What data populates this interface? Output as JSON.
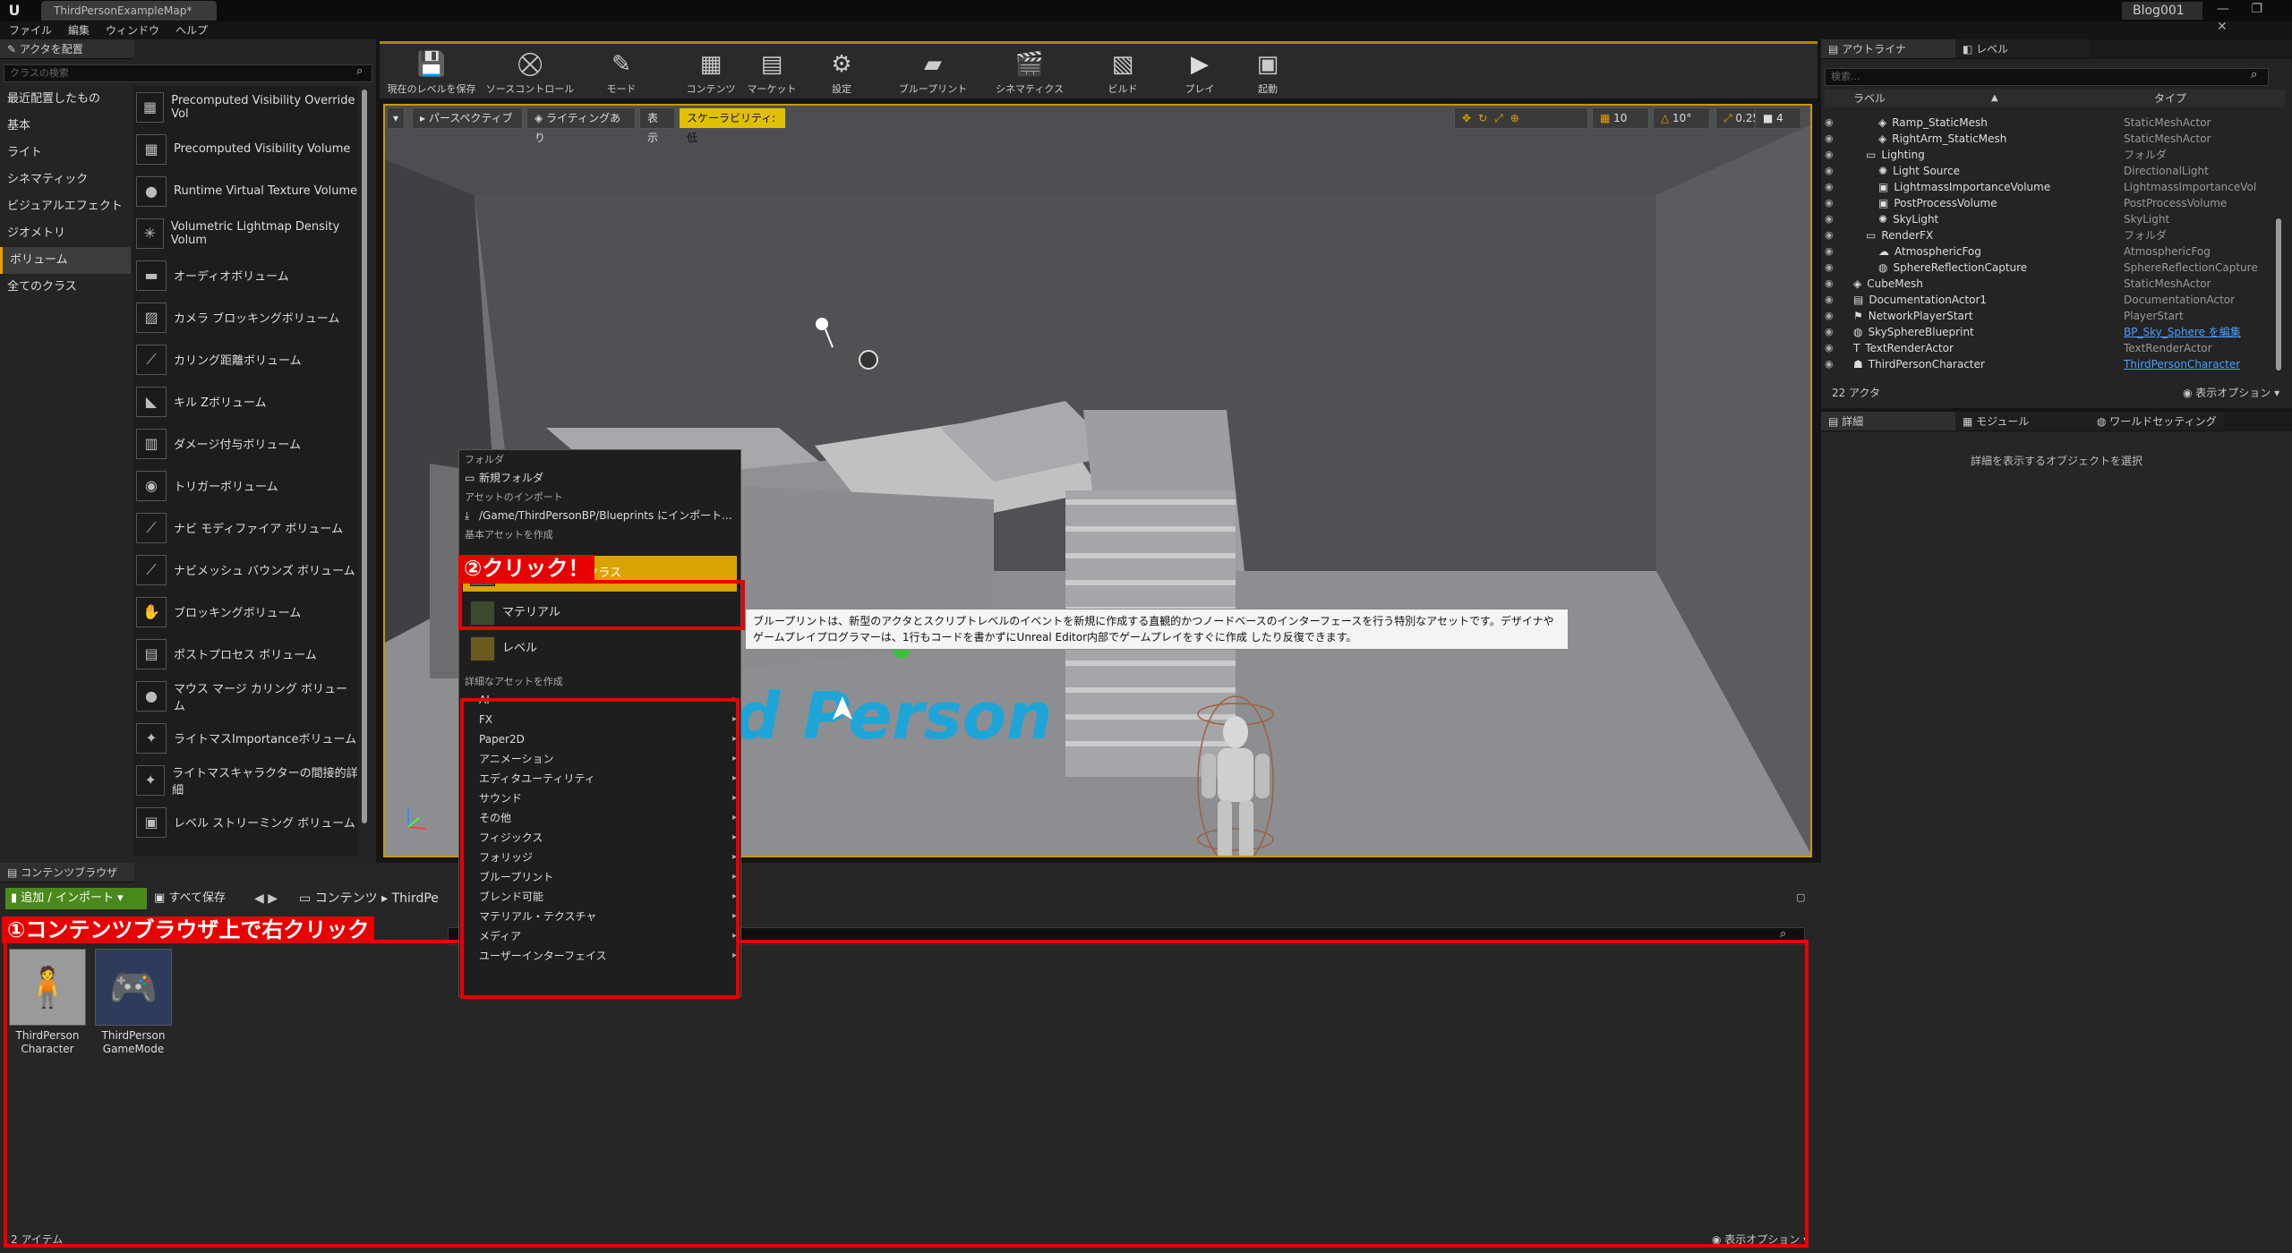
{
  "title_bar": {
    "doc_tab": "ThirdPersonExampleMap*",
    "project": "Blog001",
    "window_controls": "— ❐ ✕"
  },
  "menu": [
    "ファイル",
    "編集",
    "ウィンドウ",
    "ヘルプ"
  ],
  "place_actors": {
    "tab": "アクタを配置",
    "search_placeholder": "クラスの検索",
    "categories": [
      "最近配置したもの",
      "基本",
      "ライト",
      "シネマティック",
      "ビジュアルエフェクト",
      "ジオメトリ",
      "ボリューム",
      "全てのクラス"
    ],
    "items": [
      "Precomputed Visibility Override Vol",
      "Precomputed Visibility Volume",
      "Runtime Virtual Texture Volume",
      "Volumetric Lightmap Density Volum",
      "オーディオボリューム",
      "カメラ ブロッキングボリューム",
      "カリング距離ボリューム",
      "キル Zボリューム",
      "ダメージ付与ボリューム",
      "トリガーボリューム",
      "ナビ モディファイア ボリューム",
      "ナビメッシュ バウンズ ボリューム",
      "ブロッキングボリューム",
      "ポストプロセス ボリューム",
      "マウス マージ カリング ボリューム",
      "ライトマスImportanceボリューム",
      "ライトマスキャラクターの間接的詳細",
      "レベル ストリーミング ボリューム"
    ]
  },
  "toolbar": [
    "現在のレベルを保存",
    "ソースコントロール",
    "モード",
    "コンテンツ",
    "マーケット",
    "設定",
    "ブループリント",
    "シネマティクス",
    "ビルド",
    "プレイ",
    "起動"
  ],
  "viewport": {
    "buttons": [
      "パースペクティブ",
      "ライティングあり",
      "表示",
      "スケーラビリティ:低"
    ],
    "snap": [
      "10",
      "10°",
      "0.25",
      "4"
    ],
    "text_3d": "d Person"
  },
  "context_menu": {
    "folder_section": "フォルダ",
    "new_folder": "新規フォルダ",
    "import_section": "アセットのインポート",
    "import_path": "/Game/ThirdPersonBP/Blueprints にインポート...",
    "basic_section": "基本アセットを作成",
    "blueprint_class": "ブループリント クラス",
    "material": "マテリアル",
    "level": "レベル",
    "advanced_section": "詳細なアセットを作成",
    "advanced_items": [
      "AI",
      "FX",
      "Paper2D",
      "アニメーション",
      "エディタユーティリティ",
      "サウンド",
      "その他",
      "フィジックス",
      "フォリッジ",
      "ブループリント",
      "ブレンド可能",
      "マテリアル・テクスチャ",
      "メディア",
      "ユーザーインターフェイス"
    ]
  },
  "tooltip": "ブループリントは、新型のアクタとスクリプトレベルのイベントを新規に作成する直観的かつノードベースのインターフェースを行う特別なアセットです。デザイナやゲームプレイプログラマーは、1行もコードを書かずにUnreal Editor内部でゲームプレイをすぐに作成 したり反復できます。",
  "annotations": {
    "step1": "①コンテンツブラウザ上で右クリック",
    "step2": "②クリック！"
  },
  "outliner": {
    "tabs": [
      "アウトライナ",
      "レベル"
    ],
    "search_placeholder": "検索...",
    "col_label": "ラベル",
    "col_type": "タイプ",
    "rows": [
      {
        "label": "Ramp_StaticMesh",
        "type": "StaticMeshActor",
        "indent": 3,
        "icon": "mesh-icon"
      },
      {
        "label": "RightArm_StaticMesh",
        "type": "StaticMeshActor",
        "indent": 3,
        "icon": "mesh-icon"
      },
      {
        "label": "Lighting",
        "type": "フォルダ",
        "indent": 2,
        "icon": "folder-icon"
      },
      {
        "label": "Light Source",
        "type": "DirectionalLight",
        "indent": 3,
        "icon": "light-icon"
      },
      {
        "label": "LightmassImportanceVolume",
        "type": "LightmassImportanceVol",
        "indent": 3,
        "icon": "volume-icon"
      },
      {
        "label": "PostProcessVolume",
        "type": "PostProcessVolume",
        "indent": 3,
        "icon": "volume-icon"
      },
      {
        "label": "SkyLight",
        "type": "SkyLight",
        "indent": 3,
        "icon": "light-icon"
      },
      {
        "label": "RenderFX",
        "type": "フォルダ",
        "indent": 2,
        "icon": "folder-icon"
      },
      {
        "label": "AtmosphericFog",
        "type": "AtmosphericFog",
        "indent": 3,
        "icon": "fog-icon"
      },
      {
        "label": "SphereReflectionCapture",
        "type": "SphereReflectionCapture",
        "indent": 3,
        "icon": "sphere-icon"
      },
      {
        "label": "CubeMesh",
        "type": "StaticMeshActor",
        "indent": 1,
        "icon": "mesh-icon"
      },
      {
        "label": "DocumentationActor1",
        "type": "DocumentationActor",
        "indent": 1,
        "icon": "doc-icon"
      },
      {
        "label": "NetworkPlayerStart",
        "type": "PlayerStart",
        "indent": 1,
        "icon": "player-start-icon"
      },
      {
        "label": "SkySphereBlueprint",
        "type": "BP_Sky_Sphere を編集",
        "indent": 1,
        "icon": "sphere-icon",
        "link": true
      },
      {
        "label": "TextRenderActor",
        "type": "TextRenderActor",
        "indent": 1,
        "icon": "text-icon"
      },
      {
        "label": "ThirdPersonCharacter",
        "type": "ThirdPersonCharacter",
        "indent": 1,
        "icon": "pawn-icon",
        "link": true
      }
    ],
    "count": "22 アクタ",
    "view_options": "表示オプション"
  },
  "details": {
    "tabs": [
      "詳細",
      "モジュール",
      "ワールドセッティング"
    ],
    "empty": "詳細を表示するオブジェクトを選択"
  },
  "content_browser": {
    "tab": "コンテンツブラウザ",
    "add_import": "追加 / インポート",
    "save_all": "すべて保存",
    "path": [
      "コンテンツ",
      "ThirdPe"
    ],
    "assets": [
      {
        "name": "ThirdPerson Character"
      },
      {
        "name": "ThirdPerson GameMode"
      }
    ],
    "count": "2 アイテム",
    "view_options": "表示オプション"
  },
  "colors": {
    "accent": "#e8a000",
    "highlight": "#d9a400",
    "annotation": "#e80000",
    "add_button": "#4a8a1c"
  }
}
